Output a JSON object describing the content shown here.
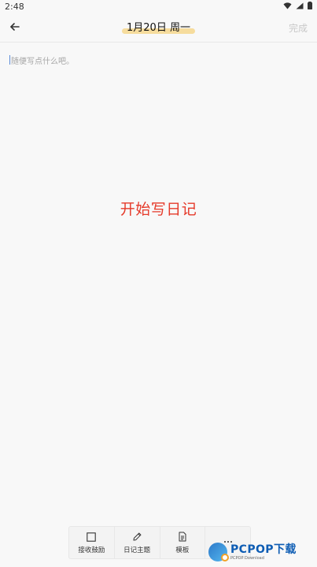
{
  "status_bar": {
    "time": "2:48"
  },
  "header": {
    "date_title": "1月20日 周一",
    "done_label": "完成"
  },
  "editor": {
    "placeholder": "随便写点什么吧。"
  },
  "content": {
    "prompt_text": "开始写日记"
  },
  "toolbar": {
    "items": [
      {
        "label": "接收鼓励",
        "icon": "checkbox-icon"
      },
      {
        "label": "日记主题",
        "icon": "pencil-icon"
      },
      {
        "label": "模板",
        "icon": "document-icon"
      },
      {
        "label": "",
        "icon": "more-icon"
      }
    ]
  },
  "watermark": {
    "title": "PCPOP下载",
    "subtitle": "PCPOP Download"
  },
  "colors": {
    "prompt": "#e53a2a",
    "highlight": "#f6dc9d",
    "done": "#c8c8c8",
    "brand_blue": "#0e5db4",
    "brand_orange": "#f2a225"
  }
}
